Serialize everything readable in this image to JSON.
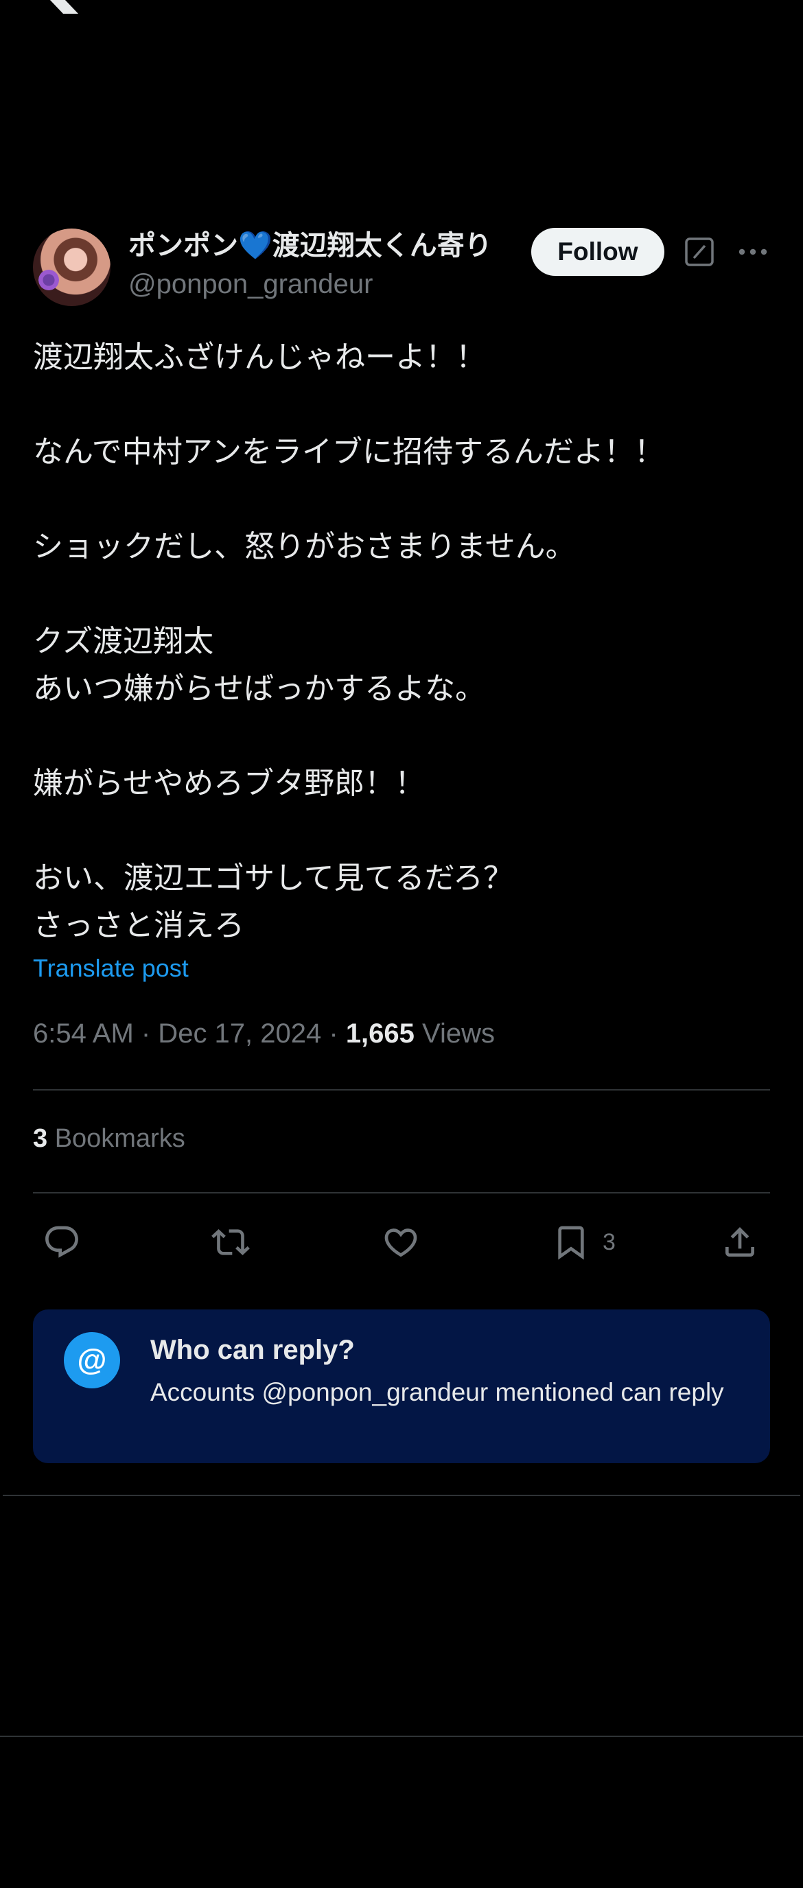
{
  "post": {
    "author": {
      "display_name": "ポンポン💙渡辺翔太くん寄り",
      "handle": "@ponpon_grandeur"
    },
    "follow_label": "Follow",
    "body_lines": [
      "渡辺翔太ふざけんじゃねーよ！！",
      "",
      "なんで中村アンをライブに招待するんだよ！！",
      "",
      "ショックだし、怒りがおさまりません。",
      "",
      "クズ渡辺翔太",
      "あいつ嫌がらせばっかするよな。",
      "",
      "嫌がらせやめろブタ野郎！！",
      "",
      "おい、渡辺エゴサして見てるだろ？",
      "さっさと消えろ"
    ],
    "translate_label": "Translate post",
    "timestamp": "6:54 AM · Dec 17, 2024 · ",
    "views_count": "1,665",
    "views_label": " Views",
    "bookmarks_count": "3",
    "bookmarks_label": " Bookmarks",
    "actions": {
      "bookmark_count": "3"
    }
  },
  "reply_restriction": {
    "title": "Who can reply?",
    "description": "Accounts @ponpon_grandeur mentioned can reply",
    "icon_glyph": "@"
  },
  "colors": {
    "background": "#000000",
    "accent": "#1d9bf0",
    "reply_card_bg": "#031645"
  }
}
